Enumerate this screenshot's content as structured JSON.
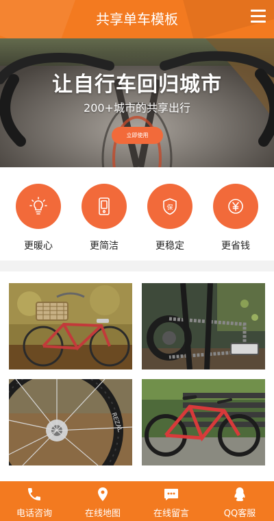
{
  "header": {
    "title": "共享单车模板",
    "menu_icon": "hamburger-menu-icon",
    "color": "#f37a20"
  },
  "hero": {
    "title": "让自行车回归城市",
    "subtitle": "200+城市的共享出行",
    "button_label": "立即使用",
    "button_color": "#f26a3a"
  },
  "features": [
    {
      "icon": "lightbulb-icon",
      "label": "更暖心"
    },
    {
      "icon": "phone-icon",
      "label": "更简洁"
    },
    {
      "icon": "shield-icon",
      "label": "更稳定"
    },
    {
      "icon": "yen-coin-icon",
      "label": "更省钱"
    }
  ],
  "gallery": [
    {
      "name": "photo-red-bike-basket"
    },
    {
      "name": "photo-bike-chain-pedal"
    },
    {
      "name": "photo-bike-wheel-closeup"
    },
    {
      "name": "photo-red-bike-bench"
    }
  ],
  "bottom_nav": [
    {
      "icon": "phone-handset-icon",
      "label": "电话咨询"
    },
    {
      "icon": "map-pin-icon",
      "label": "在线地图"
    },
    {
      "icon": "chat-bubble-icon",
      "label": "在线留言"
    },
    {
      "icon": "qq-penguin-icon",
      "label": "QQ客服"
    }
  ]
}
